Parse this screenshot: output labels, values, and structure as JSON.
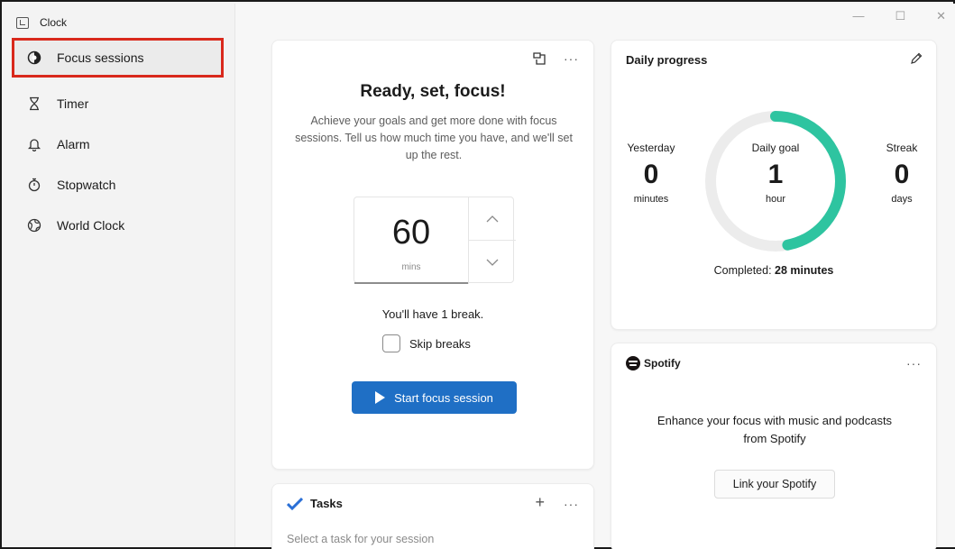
{
  "app": {
    "title": "Clock"
  },
  "window_controls": {
    "minimize": "—",
    "maximize": "☐",
    "close": "✕"
  },
  "sidebar": {
    "items": [
      {
        "label": "Focus sessions",
        "icon": "focus-icon",
        "selected": true
      },
      {
        "label": "Timer",
        "icon": "hourglass-icon",
        "selected": false
      },
      {
        "label": "Alarm",
        "icon": "bell-icon",
        "selected": false
      },
      {
        "label": "Stopwatch",
        "icon": "stopwatch-icon",
        "selected": false
      },
      {
        "label": "World Clock",
        "icon": "globe-icon",
        "selected": false
      }
    ],
    "highlight_color": "#d9291c"
  },
  "focus": {
    "title": "Ready, set, focus!",
    "description": "Achieve your goals and get more done with focus sessions. Tell us how much time you have, and we'll set up the rest.",
    "minutes_value": "60",
    "minutes_unit": "mins",
    "break_text": "You'll have 1 break.",
    "skip_breaks_label": "Skip breaks",
    "skip_breaks_checked": false,
    "start_button_label": "Start focus session",
    "accent_color": "#1f6fc5",
    "more_label": "···"
  },
  "daily_progress": {
    "title": "Daily progress",
    "yesterday": {
      "label": "Yesterday",
      "value": "0",
      "unit": "minutes"
    },
    "goal": {
      "label": "Daily goal",
      "value": "1",
      "unit": "hour"
    },
    "streak": {
      "label": "Streak",
      "value": "0",
      "unit": "days"
    },
    "completed_prefix": "Completed:",
    "completed_value": "28 minutes",
    "progress_fraction": 0.47,
    "ring_color": "#2ec4a0"
  },
  "spotify": {
    "brand": "Spotify",
    "description": "Enhance your focus with music and podcasts from Spotify",
    "link_button_label": "Link your Spotify",
    "more_label": "···"
  },
  "tasks": {
    "title": "Tasks",
    "placeholder": "Select a task for your session",
    "add_label": "+",
    "more_label": "···"
  }
}
